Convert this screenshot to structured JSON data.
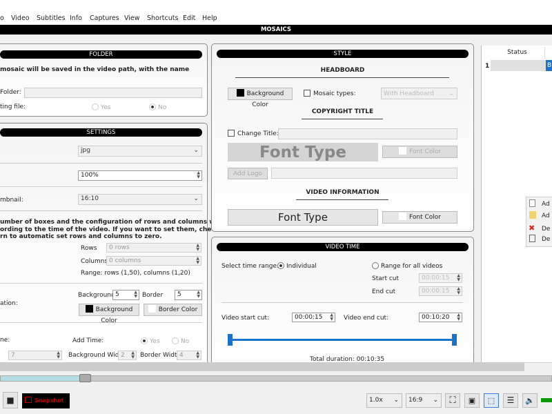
{
  "menu": [
    "o",
    "Video",
    "Subtitles",
    "Info",
    "Captures",
    "View",
    "Shortcuts",
    "Edit",
    "Help"
  ],
  "title": "MOSAICS",
  "folder": {
    "header": "FOLDER",
    "note": "mosaic will be saved in the video path, with the name",
    "folder_label": "Folder:",
    "existing_label": "ting file:",
    "yes": "Yes",
    "no": "No",
    "selected": "No"
  },
  "settings": {
    "header": "SETTINGS",
    "format": "jpg",
    "scale": "100%",
    "thumb_label": "mbnail:",
    "thumb": "16:10",
    "note": [
      "umber of boxes and the configuration of rows and columns will be",
      "ording to the time of the video. If you want to set them, check",
      "rn to automatic set rows and columns to zero."
    ],
    "rows_label": "Rows",
    "rows": "0 rows",
    "cols_label": "Columns",
    "cols": "0 columns",
    "range": "Range: rows (1,50), columns (1,20)",
    "sep_label": "ation:",
    "bg_label": "Background",
    "bg": "5",
    "border_label": "Border",
    "border": "5",
    "bg_color": "Background Color",
    "border_color": "Border Color",
    "time_label": "ne:",
    "add_time": "Add Time:",
    "yes": "Yes",
    "no": "No",
    "size": "7",
    "bgw_label": "Background Width",
    "bgw": "2",
    "bw_label": "Border Width",
    "bw": "4"
  },
  "style": {
    "header": "STYLE",
    "headboard": "HEADBOARD",
    "bg_color": "Background Color",
    "mosaic_types": "Mosaic types:",
    "mosaic_type_value": "With Headboard",
    "copyright": "COPYRIGHT TITLE",
    "change_title": "Change Title:",
    "font_type": "Font Type",
    "font_color": "Font Color",
    "add_logo": "Add Logo",
    "video_info": "VIDEO INFORMATION",
    "font_type2": "Font Type",
    "font_color2": "Font Color"
  },
  "video_time": {
    "header": "VIDEO TIME",
    "select_label": "Select time range:",
    "individual": "Individual",
    "range_all": "Range for all videos",
    "start_cut_label": "Start cut",
    "start_cut": "00:00:15",
    "end_cut_label": "End cut",
    "end_cut": "00:00:15",
    "vstart_label": "Video start cut:",
    "vstart": "00:00:15",
    "vend_label": "Video end cut:",
    "vend": "00:10:20",
    "total": "Total duration: 00:10:35"
  },
  "table": {
    "header": "Status",
    "row_num": "1",
    "cell": "B"
  },
  "context_menu": [
    {
      "icon": "file-icon",
      "label": "Ad"
    },
    {
      "icon": "folder-icon",
      "label": "Ad"
    },
    {
      "icon": "delete-x-icon",
      "label": "De"
    },
    {
      "icon": "trash-icon",
      "label": "De"
    }
  ],
  "player": {
    "snapshot": "Snapshot",
    "speed": "1.0x",
    "aspect": "16:9",
    "progress_percent": 15
  },
  "colors": {
    "accent": "#1a73c8",
    "snapshot_red": "#c00000",
    "volume_green": "#0a9a0a",
    "seek_fill": "#b5dde6"
  }
}
